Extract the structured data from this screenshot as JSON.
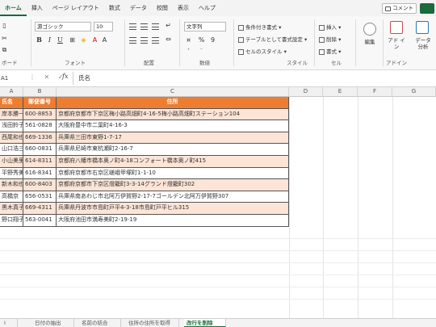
{
  "menu": {
    "tabs": [
      "ホーム",
      "挿入",
      "ページ レイアウト",
      "数式",
      "データ",
      "校閲",
      "表示",
      "ヘルプ"
    ],
    "active_tab": "ホーム",
    "comment_label": "コメント"
  },
  "ribbon": {
    "clipboard_label": "ボード",
    "font_name": "游ゴシック",
    "font_size": "10",
    "font_label": "フォント",
    "bold": "B",
    "italic": "I",
    "underline": "U",
    "align_label": "配置",
    "number_format": "文字列",
    "percent": "%",
    "comma": "9",
    "number_label": "数値",
    "cond_format": "条件付き書式",
    "table_format": "テーブルとして書式設定",
    "cell_styles": "セルのスタイル",
    "styles_label": "スタイル",
    "insert": "挿入",
    "delete": "削除",
    "format": "書式",
    "cells_label": "セル",
    "edit": "編集",
    "addins": "アド イン",
    "addins_label": "アドイン",
    "data_analysis": "データ 分析"
  },
  "formula_bar": {
    "name_box": "A1",
    "fx": "fx",
    "content": "氏名"
  },
  "columns": [
    "A",
    "B",
    "C",
    "D",
    "E",
    "F",
    "G"
  ],
  "table": {
    "headers": [
      "氏名",
      "郵便番号",
      "住所"
    ],
    "rows": [
      [
        "岸本勝一",
        "600-8853",
        "京都府京都市下京区梅小路高畑町4-16-5梅小路高畑町ステーション104"
      ],
      [
        "浅田鈴子",
        "561-0828",
        "大阪府豊中市二葉町4-16-3"
      ],
      [
        "西尾和也",
        "669-1336",
        "兵庫県三田市東野1-7-17"
      ],
      [
        "山口浩三",
        "660-0831",
        "兵庫県尼崎市東杭瀬町2-16-7"
      ],
      [
        "小山美里",
        "614-8311",
        "京都府八幡市橋本奥ノ町4-18コンフォート橋本奥ノ町415"
      ],
      [
        "平野秀美",
        "616-8341",
        "京都府京都市右京区嵯峨甲塚町1-1-10"
      ],
      [
        "新木和也",
        "600-8403",
        "京都府京都市下京区燈籠町3-3-14グランド燈籠町302"
      ],
      [
        "高橋京",
        "656-0531",
        "兵庫県南あわじ市北阿万伊賀野2-17-7ゴールデン北阿万伊賀野307"
      ],
      [
        "黒木真子",
        "669-4311",
        "兵庫県丹波市市島町戸平4-3-18市島町戸平ヒル315"
      ],
      [
        "野口翔子",
        "563-0041",
        "大阪府池田市満寿美町2-19-19"
      ]
    ]
  },
  "sheet_tabs": [
    "Ⅰ",
    "日付の抽出",
    "名前の結合",
    "住所の住所を取得",
    "改行を削除"
  ],
  "active_sheet": "改行を削除",
  "colors": {
    "header_fill": "#ed7d31",
    "band_fill": "#fce4d6",
    "accent": "#1a6b3a"
  }
}
